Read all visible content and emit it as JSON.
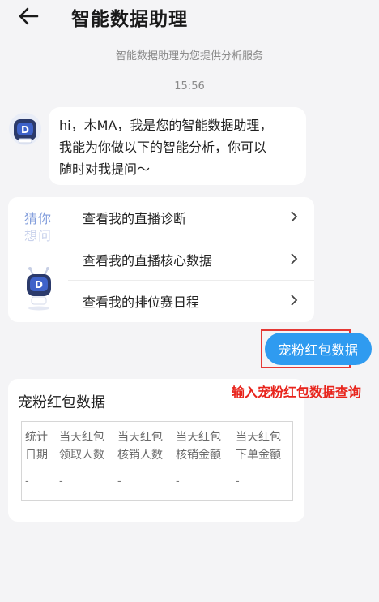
{
  "header": {
    "title": "智能数据助理",
    "back_icon": "arrow-left-icon"
  },
  "chat": {
    "service_note": "智能数据助理为您提供分析服务",
    "timestamp": "15:56",
    "greeting_lines": [
      "hi，木MA，我是您的智能数据助理，",
      "我能为你做以下的智能分析，你可以",
      "随时对我提问～"
    ],
    "suggest": {
      "guess_line1": "猜你",
      "guess_line2": "想问",
      "items": [
        "查看我的直播诊断",
        "查看我的直播核心数据",
        "查看我的排位赛日程"
      ]
    },
    "user_message": "宠粉红包数据",
    "annotation": "输入宠粉红包数据查询",
    "result": {
      "title": "宠粉红包数据",
      "headers": [
        [
          "统计",
          "日期"
        ],
        [
          "当天红包",
          "领取人数"
        ],
        [
          "当天红包",
          "核销人数"
        ],
        [
          "当天红包",
          "核销金额"
        ],
        [
          "当天红包",
          "下单金额"
        ]
      ],
      "row": [
        "-",
        "-",
        "-",
        "-",
        "-"
      ]
    }
  },
  "colors": {
    "accent": "#2f9bf0",
    "annotation": "#e8241c",
    "background": "#f4f4f6"
  }
}
